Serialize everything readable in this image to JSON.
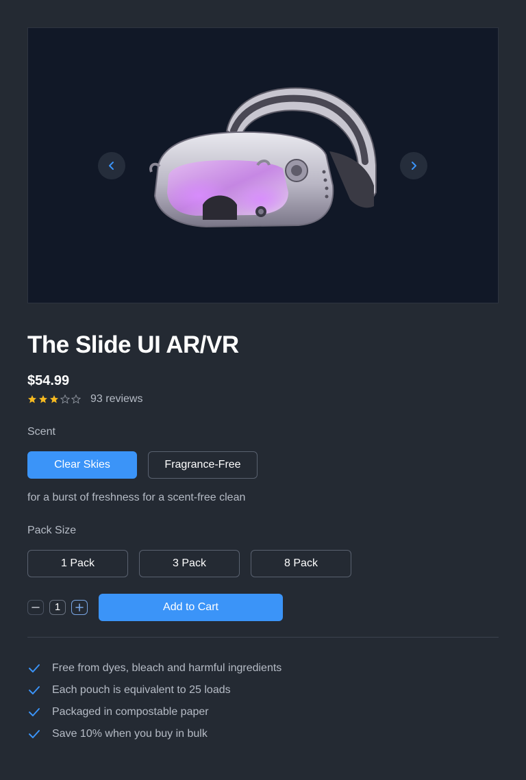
{
  "gallery": {
    "image_alt": "VR headset product image",
    "prev_icon": "chevron-left-icon",
    "next_icon": "chevron-right-icon"
  },
  "product": {
    "title": "The Slide UI AR/VR",
    "price": "$54.99",
    "rating": 3,
    "rating_max": 5,
    "reviews": "93 reviews"
  },
  "scent": {
    "label": "Scent",
    "options": [
      "Clear Skies",
      "Fragrance-Free"
    ],
    "selected": "Clear Skies",
    "description": "for a burst of freshness for a scent-free clean"
  },
  "pack": {
    "label": "Pack Size",
    "options": [
      "1 Pack",
      "3 Pack",
      "8 Pack"
    ]
  },
  "quantity": {
    "value": "1"
  },
  "cart": {
    "add_label": "Add to Cart"
  },
  "features": [
    "Free from dyes, bleach and harmful ingredients",
    "Each pouch is equivalent to 25 loads",
    "Packaged in compostable paper",
    "Save 10% when you buy in bulk"
  ],
  "colors": {
    "accent": "#3b94f8",
    "star": "#f5b921",
    "background": "#242a33",
    "gallery_bg": "#111827"
  }
}
